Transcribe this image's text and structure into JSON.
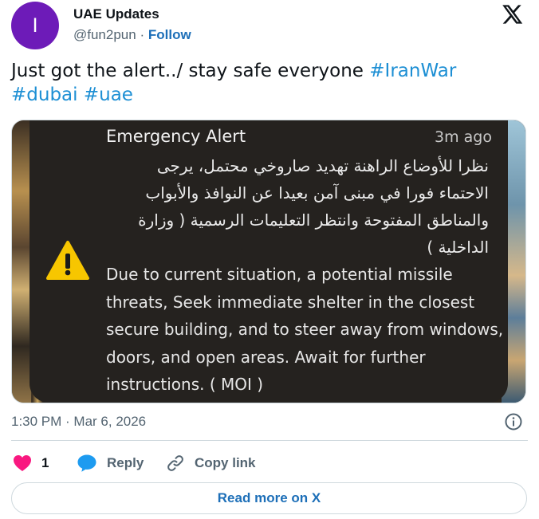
{
  "header": {
    "avatar_letter": "I",
    "display_name": "UAE Updates",
    "handle": "@fun2pun",
    "separator": "·",
    "follow_label": "Follow",
    "logo_icon": "x-logo-icon"
  },
  "tweet": {
    "text_before": "Just got the alert../ stay safe everyone ",
    "hashtags": [
      "#IranWar",
      "#dubai",
      "#uae"
    ]
  },
  "media": {
    "alert_title": "Emergency Alert",
    "alert_time": "3m ago",
    "arabic_text": "نظرا للأوضاع الراهنة تهديد صاروخي محتمل، يرجى الاحتماء فورا في مبنى آمن بعيدا عن النوافذ والأبواب والمناطق المفتوحة وانتظر التعليمات الرسمية ( وزارة الداخلية )",
    "english_text": "Due to current situation, a potential missile threats, Seek immediate shelter in the closest secure building, and to steer away from windows, doors, and open areas. Await for further instructions. ( MOI )",
    "warning_icon": "warning-triangle-icon"
  },
  "meta": {
    "timestamp": "1:30 PM · Mar 6, 2026",
    "info_icon": "info-icon"
  },
  "actions": {
    "like_count": "1",
    "reply_label": "Reply",
    "copy_label": "Copy link"
  },
  "footer": {
    "read_more_label": "Read more on X"
  },
  "colors": {
    "avatar_bg": "#6d1bb8",
    "link_blue": "#1d6fb8",
    "hashtag_blue": "#1d8fd4",
    "like_pink": "#f91880",
    "reply_blue": "#1d9bf0",
    "alert_bg": "#25221f",
    "warning_yellow": "#f7c600"
  }
}
